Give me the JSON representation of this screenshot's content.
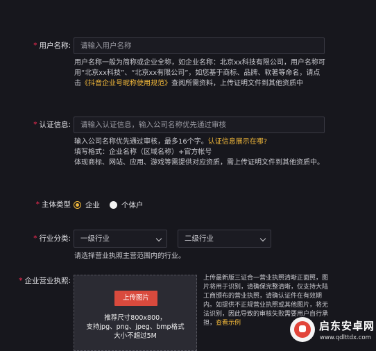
{
  "username": {
    "required_mark": "*",
    "label": "用户名称:",
    "placeholder": "请输入用户名称",
    "help_1": "用户名称一般为简称或企业全称，如企业名称：北京xx科技有限公司，用户名称可用“北京xx科技”、“北京xx有限公司”，如您基于商标、品牌、软著等命名，请点击",
    "help_link": "《抖音企业号昵称使用规范》",
    "help_2": "查阅所需资料，上传证明文件到其他资质中"
  },
  "verification": {
    "required_mark": "*",
    "label": "认证信息:",
    "placeholder": "请输入认证信息，输入公司名称优先通过审核",
    "help_1": "输入公司名称优先通过审核，最多16个字。",
    "help_link": "认证信息展示在哪?",
    "help_line2": "填写格式：企业名称（区域名称）+官方帐号",
    "help_line3": "体现商标、网站、应用、游戏等需提供对应资质，需上传证明文件到其他资质中。"
  },
  "entity_type": {
    "required_mark": "*",
    "label": "主体类型",
    "option_1": "企业",
    "option_2": "个体户",
    "selected": "企业"
  },
  "industry": {
    "required_mark": "*",
    "label": "行业分类:",
    "select_1": "一级行业",
    "select_2": "二级行业",
    "help": "请选择营业执照主营范围内的行业。"
  },
  "license": {
    "required_mark": "*",
    "label": "企业营业执照:",
    "upload_button": "上传图片",
    "hint_1": "推荐尺寸800x800，",
    "hint_2": "支持jpg、png、jpeg、bmp格式",
    "hint_3": "大小不超过5M",
    "note": "上传最新版三证合一营业执照清晰正面照，图片将用于识别，请确保完整清晰，仅支持大陆工商颁布的营业执照，请确认证件在有效期内。如提供不正规营业执照或其他图片，将无法识别，因此导致的审核失败需要用户自行承担，",
    "note_link": "查看示例"
  },
  "watermark": {
    "title": "启东安卓网",
    "url": "www.qdlttdx.com"
  },
  "colors": {
    "background": "#17171d",
    "accent": "#f0b73a",
    "required": "#fe2c55",
    "upload_button": "#d94a3d"
  }
}
